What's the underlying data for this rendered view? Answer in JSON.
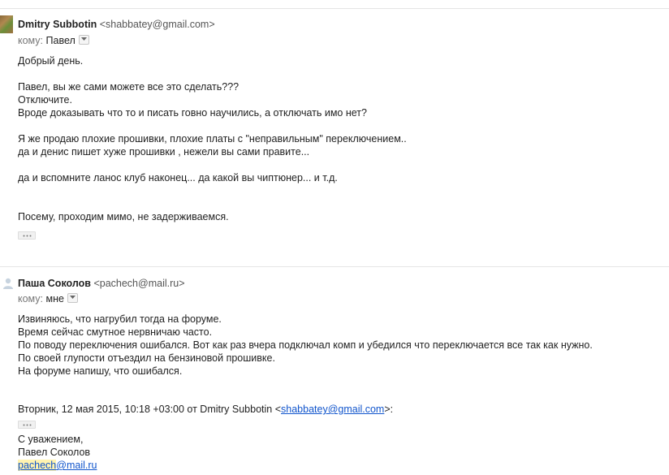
{
  "message1": {
    "sender_name": "Dmitry Subbotin",
    "sender_email": "<shabbatey@gmail.com>",
    "to_label": "кому:",
    "to_name": "Павел",
    "body_lines": [
      "Добрый день.",
      "",
      "Павел, вы же сами можете все это сделать???",
      "Отключите.",
      "Вроде доказывать что то и писать говно научились, а отключать имо нет?",
      "",
      "Я же продаю плохие прошивки, плохие платы с \"неправильным\" переключением..",
      "да и денис пишет хуже прошивки , нежели вы сами правите...",
      "",
      "да и вспомните ланос клуб наконец... да какой вы чиптюнер... и т.д.",
      "",
      "",
      "Посему, проходим мимо, не задерживаемся."
    ]
  },
  "message2": {
    "sender_name": "Паша Соколов",
    "sender_email": "<pachech@mail.ru>",
    "to_label": "кому:",
    "to_name": "мне",
    "body_lines": [
      "Извиняюсь, что нагрубил тогда на форуме.",
      "Время сейчас смутное нервничаю часто.",
      "По поводу переключения ошибался. Вот как раз вчера подключал комп и убедился что переключается все так как нужно.",
      "По своей глупости отъездил на бензиновой прошивке.",
      "На форуме напишу, что ошибался."
    ],
    "quote_prefix": "Вторник, 12 мая 2015, 10:18 +03:00 от Dmitry Subbotin <",
    "quote_email": "shabbatey@gmail.com",
    "quote_suffix": ">:",
    "signature": {
      "line1": "С уважением,",
      "line2": "Павел Соколов",
      "email_user": "pachech",
      "email_domain": "@mail.ru"
    }
  },
  "icons": {
    "avatar1": "contact-photo",
    "avatar2": "default-person-icon",
    "dropdown": "chevron-down-icon",
    "trimmed": "ellipsis-icon"
  }
}
